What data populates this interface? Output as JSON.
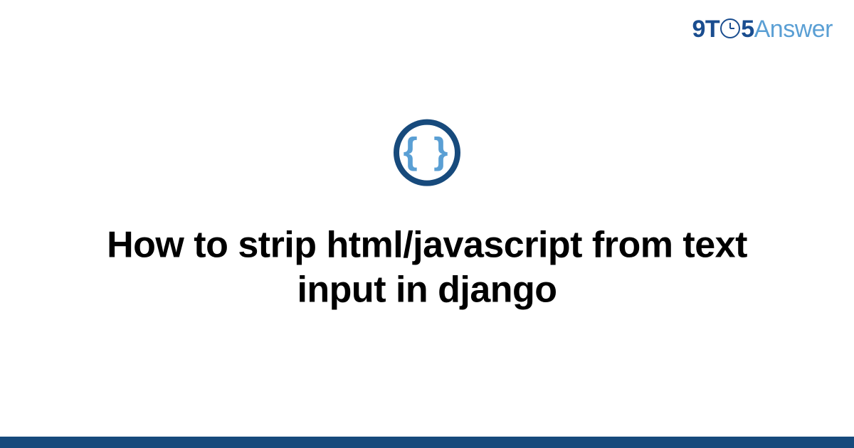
{
  "logo": {
    "part1": "9T",
    "part2": "5",
    "part3": "Answer"
  },
  "category_icon": {
    "symbol": "{ }",
    "name": "code-braces"
  },
  "title": "How to strip html/javascript from text input in django",
  "colors": {
    "brand_dark": "#174a7c",
    "brand_light": "#5a9fd4"
  }
}
